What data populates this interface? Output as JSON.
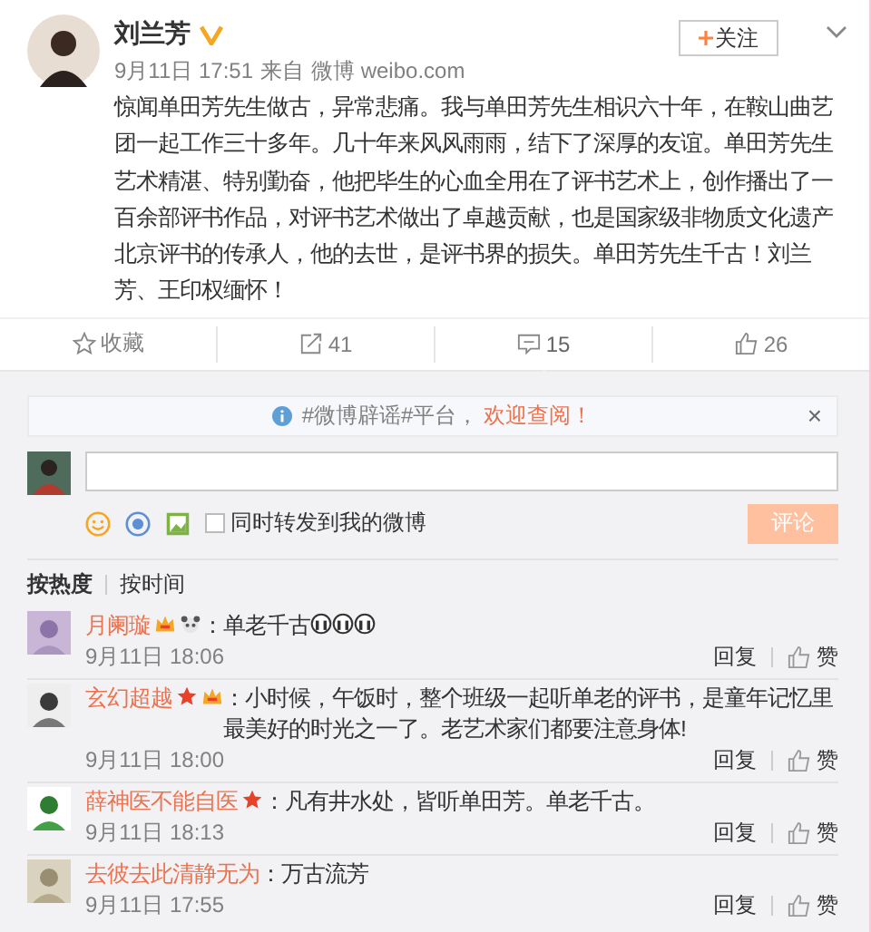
{
  "post": {
    "author": "刘兰芳",
    "verified": true,
    "follow_label": "关注",
    "time": "9月11日 17:51",
    "source_prefix": "来自",
    "source": "微博 weibo.com",
    "text": "惊闻单田芳先生做古，异常悲痛。我与单田芳先生相识六十年，在鞍山曲艺团一起工作三十多年。几十年来风风雨雨，结下了深厚的友谊。单田芳先生艺术精湛、特别勤奋，他把毕生的心血全用在了评书艺术上，创作播出了一百余部评书作品，对评书艺术做出了卓越贡献，也是国家级非物质文化遗产北京评书的传承人，他的去世，是评书界的损失。单田芳先生千古！刘兰芳、王印权缅怀！"
  },
  "actions": [
    {
      "kind": "favorite",
      "label": "收藏",
      "selected": false
    },
    {
      "kind": "repost",
      "label": "41",
      "selected": false
    },
    {
      "kind": "comment",
      "label": "15",
      "selected": true
    },
    {
      "kind": "like",
      "label": "26",
      "selected": false
    }
  ],
  "notice": {
    "text": "#微博辟谣#平台，",
    "link": "欢迎查阅！",
    "close": "×"
  },
  "composer": {
    "also_repost": {
      "label": "同时转发到我的微博",
      "checked": false
    },
    "submit": {
      "label": "评论",
      "disabled": true
    }
  },
  "sort_tabs": [
    {
      "label": "按热度",
      "selected": true
    },
    {
      "label": "按时间",
      "selected": false
    }
  ],
  "comments": [
    {
      "name": "月阑璇",
      "badges": [
        {
          "kind": "vip"
        },
        {
          "kind": "panda"
        }
      ],
      "text": "：单老千古",
      "emoticons": [
        {
          "kind": "cry"
        },
        {
          "kind": "cry"
        },
        {
          "kind": "cry"
        }
      ],
      "time": "9月11日 18:06",
      "reply": "回复",
      "like": "赞"
    },
    {
      "name": "玄幻超越",
      "badges": [
        {
          "kind": "star"
        },
        {
          "kind": "vip"
        }
      ],
      "text": "：小时候，午饭时，整个班级一起听单老的评书，是童年记忆里最美好的时光之一了。老艺术家们都要注意身体!",
      "time": "9月11日 18:00",
      "reply": "回复",
      "like": "赞"
    },
    {
      "name": "薛神医不能自医",
      "badges": [
        {
          "kind": "star"
        }
      ],
      "text": "：凡有井水处，皆听单田芳。单老千古。",
      "time": "9月11日 18:13",
      "reply": "回复",
      "like": "赞"
    },
    {
      "name": "去彼去此清静无为",
      "text": "：万古流芳",
      "time": "9月11日 17:55",
      "reply": "回复",
      "like": "赞"
    }
  ]
}
